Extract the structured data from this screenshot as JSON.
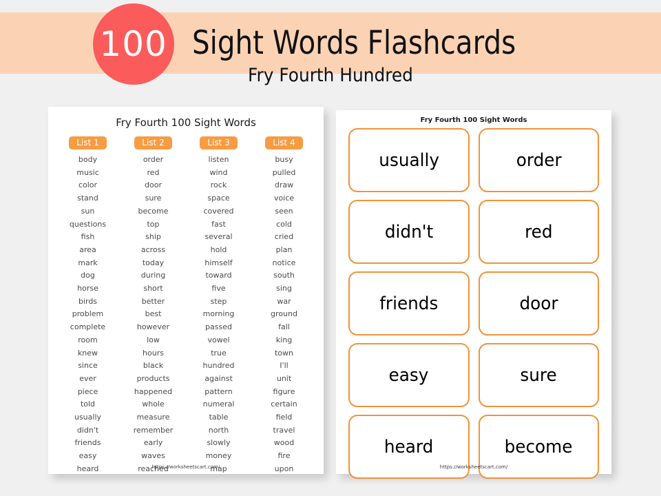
{
  "header": {
    "badge_number": "100",
    "title": "Sight Words Flashcards",
    "subtitle": "Fry Fourth Hundred",
    "banner_color": "#fbd3b4",
    "badge_color": "#fb5b5b"
  },
  "page_background": "#f0f0f0",
  "accent_orange": "#f79c42",
  "card_border_color": "#f1923a",
  "word_list_sheet": {
    "title": "Fry Fourth 100 Sight Words",
    "footer_url": "https://worksheetscart.com/",
    "columns": [
      {
        "label": "List 1",
        "words": [
          "body",
          "music",
          "color",
          "stand",
          "sun",
          "questions",
          "fish",
          "area",
          "mark",
          "dog",
          "horse",
          "birds",
          "problem",
          "complete",
          "room",
          "knew",
          "since",
          "ever",
          "piece",
          "told",
          "usually",
          "didn't",
          "friends",
          "easy",
          "heard"
        ]
      },
      {
        "label": "List 2",
        "words": [
          "order",
          "red",
          "door",
          "sure",
          "become",
          "top",
          "ship",
          "across",
          "today",
          "during",
          "short",
          "better",
          "best",
          "however",
          "low",
          "hours",
          "black",
          "products",
          "happened",
          "whole",
          "measure",
          "remember",
          "early",
          "waves",
          "reached"
        ]
      },
      {
        "label": "List 3",
        "words": [
          "listen",
          "wind",
          "rock",
          "space",
          "covered",
          "fast",
          "several",
          "hold",
          "himself",
          "toward",
          "five",
          "step",
          "morning",
          "passed",
          "vowel",
          "true",
          "hundred",
          "against",
          "pattern",
          "numeral",
          "table",
          "north",
          "slowly",
          "money",
          "map"
        ]
      },
      {
        "label": "List 4",
        "words": [
          "busy",
          "pulled",
          "draw",
          "voice",
          "seen",
          "cold",
          "cried",
          "plan",
          "notice",
          "south",
          "sing",
          "war",
          "ground",
          "fall",
          "king",
          "town",
          "I'll",
          "unit",
          "figure",
          "certain",
          "field",
          "travel",
          "wood",
          "fire",
          "upon"
        ]
      }
    ]
  },
  "flashcard_sheet": {
    "title": "Fry Fourth 100 Sight Words",
    "footer_url": "https://worksheetscart.com/",
    "cards": [
      "usually",
      "order",
      "didn't",
      "red",
      "friends",
      "door",
      "easy",
      "sure",
      "heard",
      "become"
    ]
  }
}
